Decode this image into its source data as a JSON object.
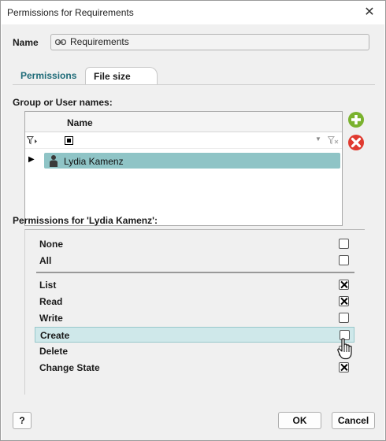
{
  "window": {
    "title": "Permissions for Requirements",
    "close_glyph": "✕"
  },
  "name": {
    "label": "Name",
    "value": "Requirements",
    "icon": "link-icon"
  },
  "tabs": [
    {
      "label": "Permissions",
      "active": true
    },
    {
      "label": "File size",
      "active": false
    }
  ],
  "groups": {
    "label": "Group or User names:",
    "column_name": "Name",
    "rows": [
      {
        "name": "Lydia Kamenz",
        "icon": "user-icon",
        "selected": true
      }
    ],
    "add_icon": "plus-circle-icon",
    "remove_icon": "remove-circle-icon"
  },
  "permissions": {
    "label": "Permissions for 'Lydia Kamenz':",
    "items": [
      {
        "label": "None",
        "checked": false
      },
      {
        "label": "All",
        "checked": false
      },
      {
        "label": "List",
        "checked": true
      },
      {
        "label": "Read",
        "checked": true
      },
      {
        "label": "Write",
        "checked": false
      },
      {
        "label": "Create",
        "checked": false,
        "hovered": true
      },
      {
        "label": "Delete",
        "checked": false
      },
      {
        "label": "Change State",
        "checked": true
      }
    ]
  },
  "footer": {
    "help_label": "?",
    "ok_label": "OK",
    "cancel_label": "Cancel"
  },
  "colors": {
    "accent": "#1e6b78",
    "selection": "#8fc4c6",
    "hover": "#cfe8ea",
    "add": "#7ab22e",
    "remove": "#e03a2f"
  }
}
